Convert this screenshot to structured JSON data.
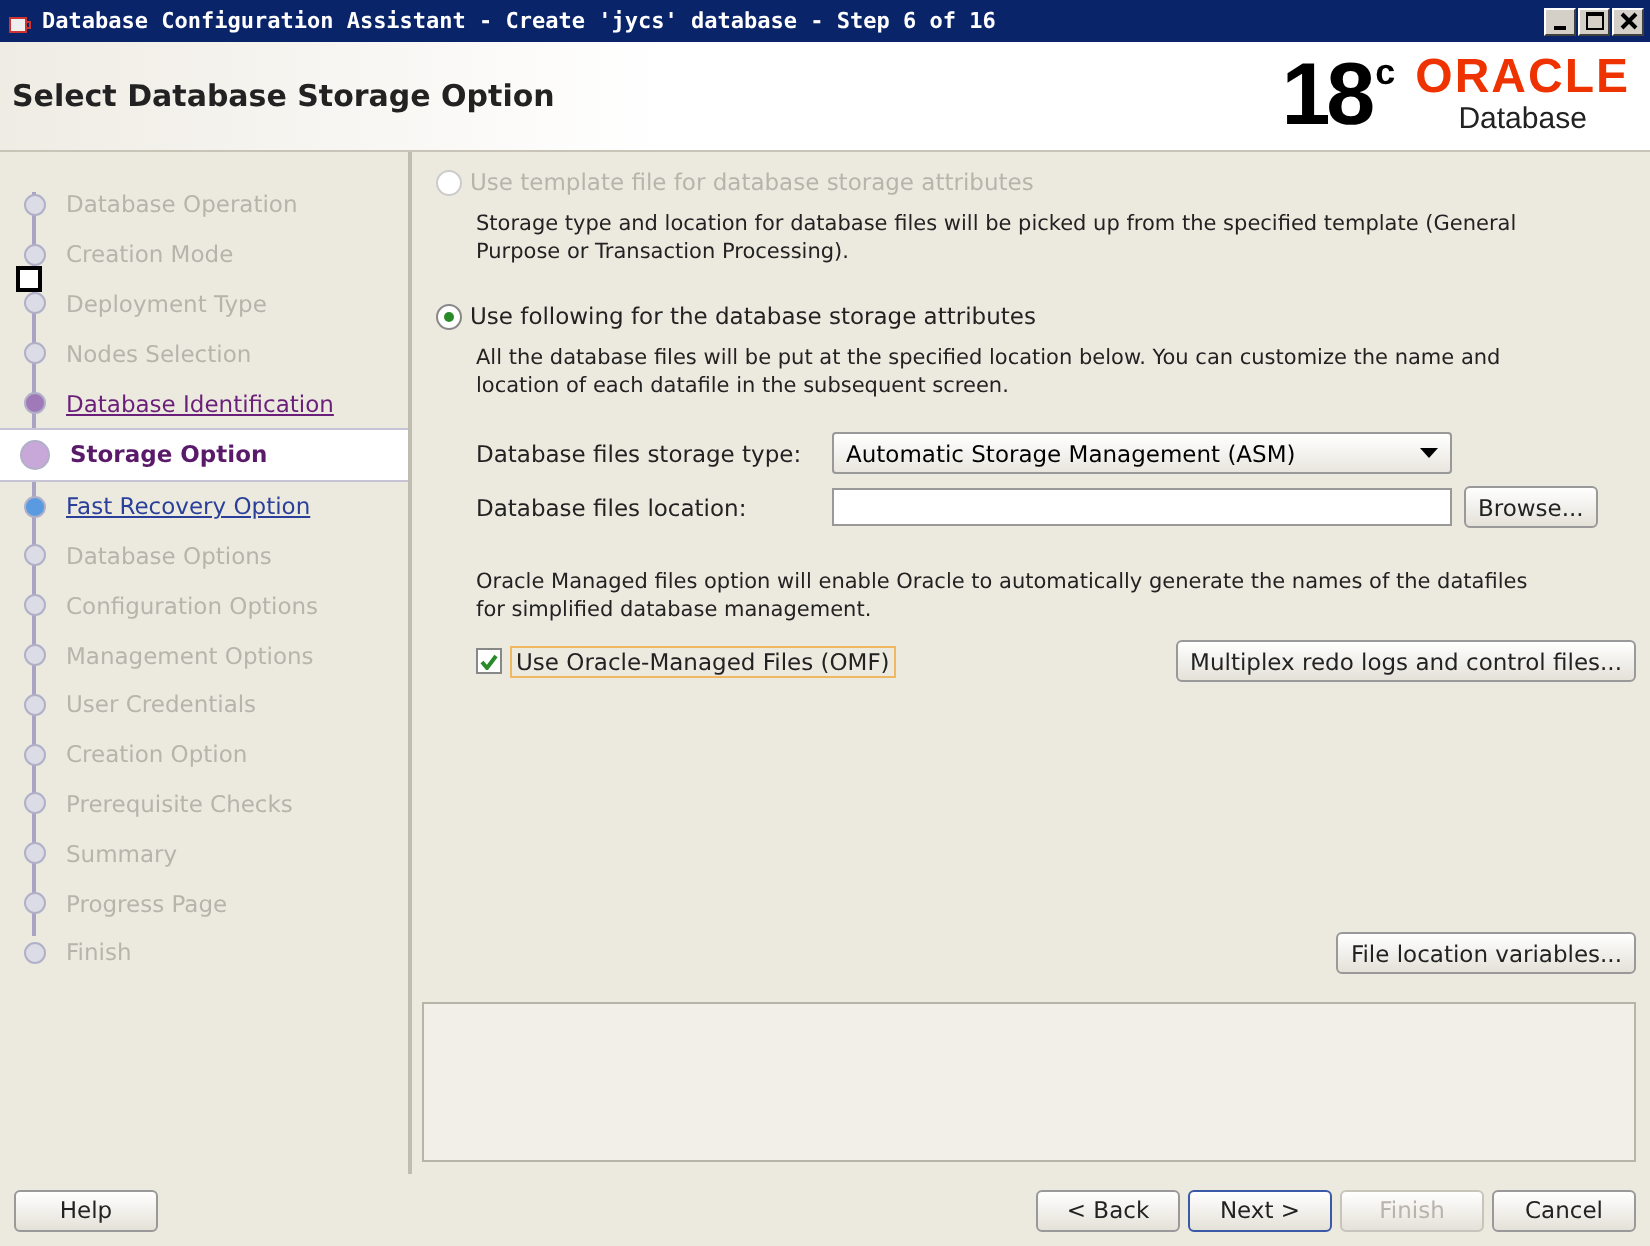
{
  "window": {
    "title": "Database Configuration Assistant - Create 'jycs' database - Step 6 of 16"
  },
  "header": {
    "title": "Select Database Storage Option",
    "logo_version": "18",
    "logo_superscript": "c",
    "logo_brand": "ORACLE",
    "logo_product": "Database"
  },
  "steps": [
    {
      "label": "Database Operation",
      "kind": "disabled"
    },
    {
      "label": "Creation Mode",
      "kind": "disabled"
    },
    {
      "label": "Deployment Type",
      "kind": "disabled"
    },
    {
      "label": "Nodes Selection",
      "kind": "disabled"
    },
    {
      "label": "Database Identification",
      "kind": "visited"
    },
    {
      "label": "Storage Option",
      "kind": "current"
    },
    {
      "label": "Fast Recovery Option",
      "kind": "link"
    },
    {
      "label": "Database Options",
      "kind": "disabled"
    },
    {
      "label": "Configuration Options",
      "kind": "disabled"
    },
    {
      "label": "Management Options",
      "kind": "disabled"
    },
    {
      "label": "User Credentials",
      "kind": "disabled"
    },
    {
      "label": "Creation Option",
      "kind": "disabled"
    },
    {
      "label": "Prerequisite Checks",
      "kind": "disabled"
    },
    {
      "label": "Summary",
      "kind": "disabled"
    },
    {
      "label": "Progress Page",
      "kind": "disabled"
    },
    {
      "label": "Finish",
      "kind": "disabled"
    }
  ],
  "options": [
    {
      "label": "Use template file for database storage attributes",
      "selected": false,
      "disabled": true,
      "description": "Storage type and location for database files will be picked up from the specified template (General Purpose or Transaction Processing)."
    },
    {
      "label": "Use following for the database storage attributes",
      "selected": true,
      "disabled": false,
      "description": "All the database files will be put at the specified location below. You can customize the name and location of each datafile in the subsequent screen."
    }
  ],
  "storage_type": {
    "label": "Database files storage type:",
    "value": "Automatic Storage Management (ASM)"
  },
  "files_location": {
    "label": "Database files location:",
    "browse": "Browse..."
  },
  "omf_note": "Oracle Managed files option will enable Oracle to automatically generate the names of the datafiles for simplified database management.",
  "omf": {
    "label": "Use Oracle-Managed Files (OMF)",
    "checked": true
  },
  "multiplex_button": "Multiplex redo logs and control files...",
  "file_location_button": "File location variables...",
  "buttons": [
    {
      "label": "Help",
      "disabled": false,
      "focused": false
    },
    {
      "label": "< Back",
      "disabled": false,
      "focused": false
    },
    {
      "label": "Next >",
      "disabled": false,
      "focused": true
    },
    {
      "label": "Finish",
      "disabled": true,
      "focused": false
    },
    {
      "label": "Cancel",
      "disabled": false,
      "focused": false
    }
  ]
}
